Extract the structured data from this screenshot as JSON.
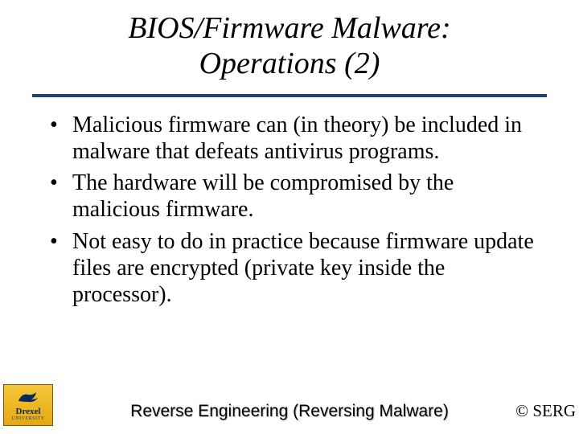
{
  "title_line1": "BIOS/Firmware Malware:",
  "title_line2": "Operations (2)",
  "bullets": [
    "Malicious firmware can (in theory) be included in malware that defeats antivirus programs.",
    "The hardware will be compromised by the malicious firmware.",
    "Not easy to do in practice because firmware update files are encrypted (private key inside the processor)."
  ],
  "logo": {
    "name": "Drexel",
    "sub": "UNIVERSITY"
  },
  "footer_title": "Reverse Engineering (Reversing Malware)",
  "copyright": "© SERG"
}
